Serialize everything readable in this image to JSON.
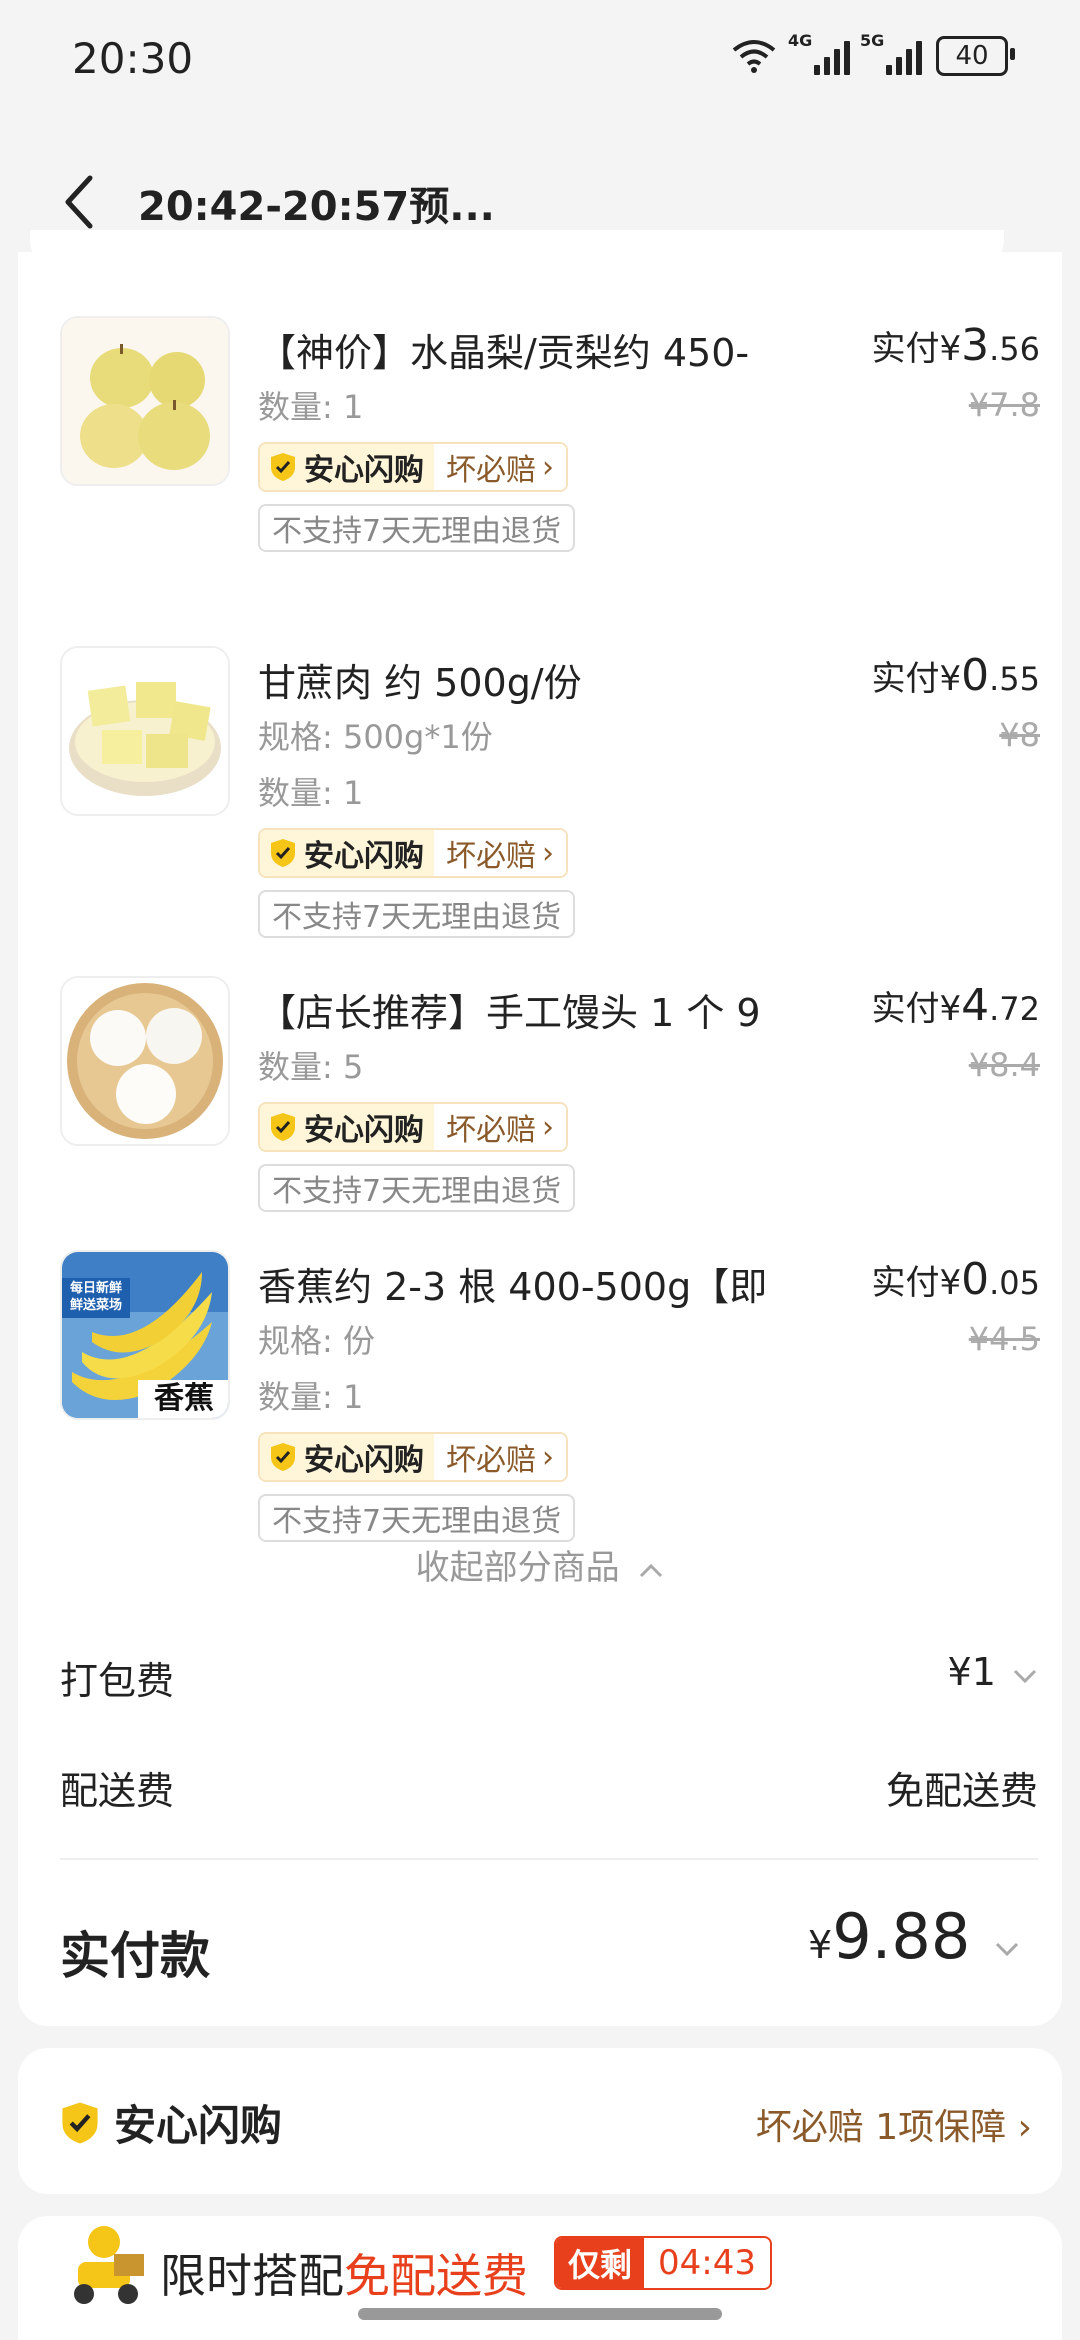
{
  "status": {
    "time": "20:30",
    "net1": "4G",
    "net2": "5G",
    "battery": "40"
  },
  "header": {
    "title": "20:42-20:57预..."
  },
  "items": [
    {
      "name": "【神价】水晶梨/贡梨约 450-",
      "spec": "",
      "qty": "数量: 1",
      "price_prefix": "实付¥",
      "price_int": "3",
      "price_dec": ".56",
      "orig": "¥7.8",
      "badge_left": "安心闪购",
      "badge_right": "坏必赔",
      "nonreturn": "不支持7天无理由退货"
    },
    {
      "name": "甘蔗肉 约 500g/份",
      "spec": "规格: 500g*1份",
      "qty": "数量: 1",
      "price_prefix": "实付¥",
      "price_int": "0",
      "price_dec": ".55",
      "orig": "¥8",
      "badge_left": "安心闪购",
      "badge_right": "坏必赔",
      "nonreturn": "不支持7天无理由退货"
    },
    {
      "name": "【店长推荐】手工馒头 1 个 9",
      "spec": "",
      "qty": "数量: 5",
      "price_prefix": "实付¥",
      "price_int": "4",
      "price_dec": ".72",
      "orig": "¥8.4",
      "badge_left": "安心闪购",
      "badge_right": "坏必赔",
      "nonreturn": "不支持7天无理由退货"
    },
    {
      "name": "香蕉约 2-3 根 400-500g【即",
      "spec": "规格: 份",
      "qty": "数量: 1",
      "price_prefix": "实付¥",
      "price_int": "0",
      "price_dec": ".05",
      "orig": "¥4.5",
      "badge_left": "安心闪购",
      "badge_right": "坏必赔",
      "nonreturn": "不支持7天无理由退货",
      "thumb_tag": "每日新鲜 鲜送菜场",
      "thumb_label": "香蕉"
    }
  ],
  "collapse": "收起部分商品",
  "fees": {
    "packing_label": "打包费",
    "packing_value": "¥1",
    "delivery_label": "配送费",
    "delivery_value": "免配送费"
  },
  "total": {
    "label": "实付款",
    "currency": "¥",
    "amount": "9.88"
  },
  "guarantee": {
    "title": "安心闪购",
    "detail": "坏必赔 1项保障"
  },
  "promo": {
    "text_black": "限时搭配",
    "text_red": "免配送费",
    "remain_label": "仅剩",
    "remain_time": "04:43"
  },
  "colors": {
    "accent_red": "#e8401c",
    "badge_bg": "#fff6d9",
    "badge_text": "#8a5a2a"
  }
}
